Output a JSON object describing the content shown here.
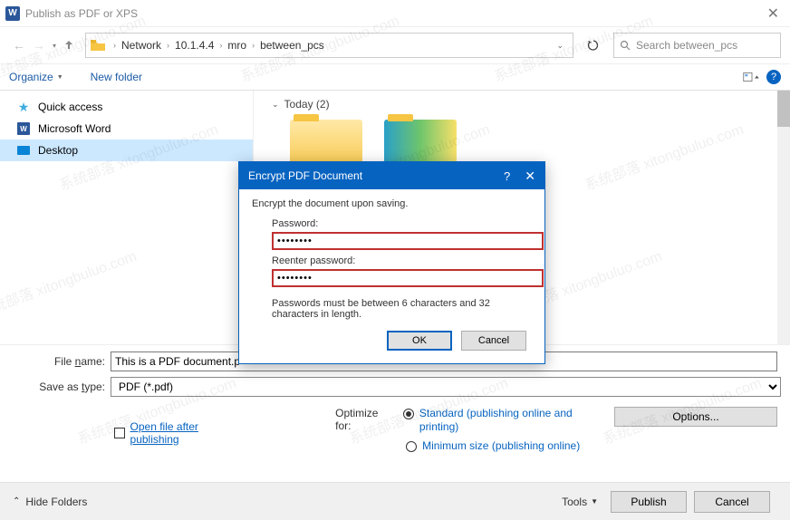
{
  "window": {
    "title": "Publish as PDF or XPS",
    "close": "✕"
  },
  "path": {
    "segments": [
      "Network",
      "10.1.4.4",
      "mro",
      "between_pcs"
    ]
  },
  "search": {
    "placeholder": "Search between_pcs"
  },
  "toolbar": {
    "organize": "Organize",
    "newfolder": "New folder"
  },
  "sidebar": {
    "items": [
      {
        "label": "Quick access"
      },
      {
        "label": "Microsoft Word"
      },
      {
        "label": "Desktop"
      }
    ]
  },
  "content": {
    "group": "Today (2)"
  },
  "form": {
    "filename_label": "File name:",
    "filename_value": "This is a PDF document.p",
    "saveas_label": "Save as type:",
    "saveas_value": "PDF (*.pdf)",
    "open_after": "Open file after publishing",
    "optimize_label": "Optimize for:",
    "opt_standard": "Standard (publishing online and printing)",
    "opt_minimum": "Minimum size (publishing online)",
    "options_btn": "Options..."
  },
  "bottom": {
    "hide": "Hide Folders",
    "tools": "Tools",
    "publish": "Publish",
    "cancel": "Cancel"
  },
  "modal": {
    "title": "Encrypt PDF Document",
    "intro": "Encrypt the document upon saving.",
    "pw_label": "Password:",
    "pw_value": "********",
    "repw_label": "Reenter password:",
    "repw_value": "********",
    "hint": "Passwords must be between 6 characters and 32 characters in length.",
    "ok": "OK",
    "cancel": "Cancel"
  },
  "watermark": "系统部落 xitongbuluo.com"
}
